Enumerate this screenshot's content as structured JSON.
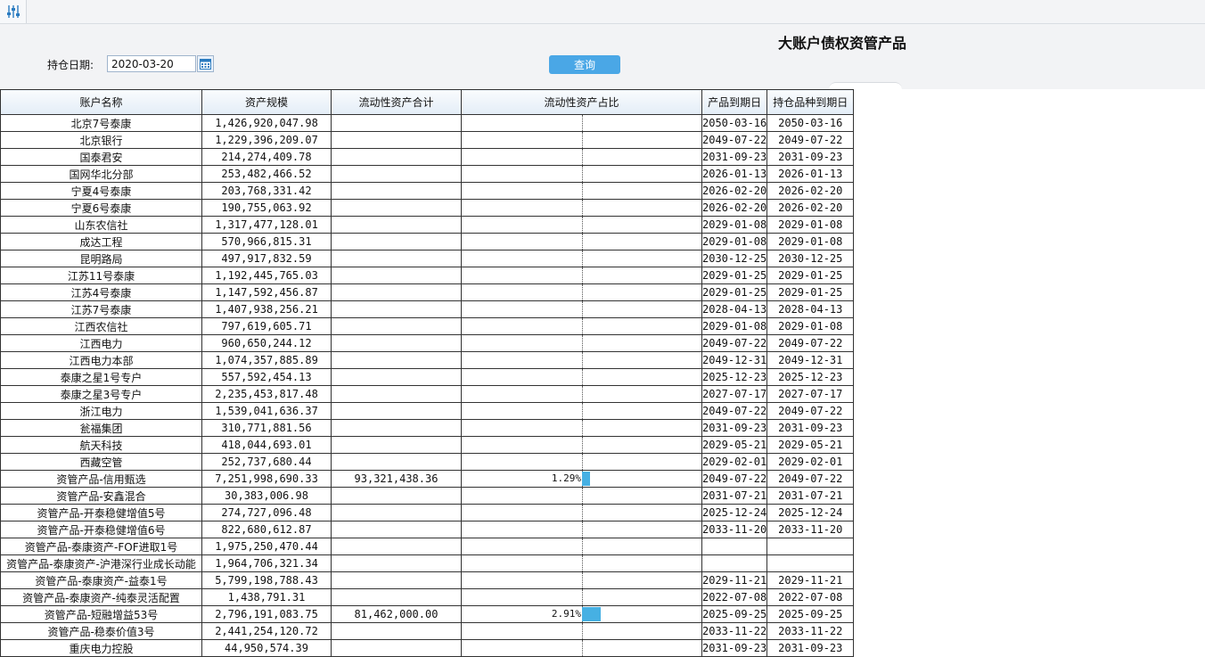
{
  "toolbar": {
    "filter_icon": "sliders-icon"
  },
  "page": {
    "title": "大账户债权资管产品"
  },
  "search": {
    "date_label": "持仓日期:",
    "date_value": "2020-03-20",
    "query_label": "查询"
  },
  "table": {
    "columns": [
      "账户名称",
      "资产规模",
      "流动性资产合计",
      "流动性资产占比",
      "产品到期日",
      "持仓品种到期日"
    ],
    "rows": [
      {
        "name": "北京7号泰康",
        "scale": "1,426,920,047.98",
        "liquid": "",
        "ratio": "",
        "ratio_value": 0,
        "due": "2050-03-16",
        "hold_due": "2050-03-16"
      },
      {
        "name": "北京银行",
        "scale": "1,229,396,209.07",
        "liquid": "",
        "ratio": "",
        "ratio_value": 0,
        "due": "2049-07-22",
        "hold_due": "2049-07-22"
      },
      {
        "name": "国泰君安",
        "scale": "214,274,409.78",
        "liquid": "",
        "ratio": "",
        "ratio_value": 0,
        "due": "2031-09-23",
        "hold_due": "2031-09-23"
      },
      {
        "name": "国网华北分部",
        "scale": "253,482,466.52",
        "liquid": "",
        "ratio": "",
        "ratio_value": 0,
        "due": "2026-01-13",
        "hold_due": "2026-01-13"
      },
      {
        "name": "宁夏4号泰康",
        "scale": "203,768,331.42",
        "liquid": "",
        "ratio": "",
        "ratio_value": 0,
        "due": "2026-02-20",
        "hold_due": "2026-02-20"
      },
      {
        "name": "宁夏6号泰康",
        "scale": "190,755,063.92",
        "liquid": "",
        "ratio": "",
        "ratio_value": 0,
        "due": "2026-02-20",
        "hold_due": "2026-02-20"
      },
      {
        "name": "山东农信社",
        "scale": "1,317,477,128.01",
        "liquid": "",
        "ratio": "",
        "ratio_value": 0,
        "due": "2029-01-08",
        "hold_due": "2029-01-08"
      },
      {
        "name": "成达工程",
        "scale": "570,966,815.31",
        "liquid": "",
        "ratio": "",
        "ratio_value": 0,
        "due": "2029-01-08",
        "hold_due": "2029-01-08"
      },
      {
        "name": "昆明路局",
        "scale": "497,917,832.59",
        "liquid": "",
        "ratio": "",
        "ratio_value": 0,
        "due": "2030-12-25",
        "hold_due": "2030-12-25"
      },
      {
        "name": "江苏11号泰康",
        "scale": "1,192,445,765.03",
        "liquid": "",
        "ratio": "",
        "ratio_value": 0,
        "due": "2029-01-25",
        "hold_due": "2029-01-25"
      },
      {
        "name": "江苏4号泰康",
        "scale": "1,147,592,456.87",
        "liquid": "",
        "ratio": "",
        "ratio_value": 0,
        "due": "2029-01-25",
        "hold_due": "2029-01-25"
      },
      {
        "name": "江苏7号泰康",
        "scale": "1,407,938,256.21",
        "liquid": "",
        "ratio": "",
        "ratio_value": 0,
        "due": "2028-04-13",
        "hold_due": "2028-04-13"
      },
      {
        "name": "江西农信社",
        "scale": "797,619,605.71",
        "liquid": "",
        "ratio": "",
        "ratio_value": 0,
        "due": "2029-01-08",
        "hold_due": "2029-01-08"
      },
      {
        "name": "江西电力",
        "scale": "960,650,244.12",
        "liquid": "",
        "ratio": "",
        "ratio_value": 0,
        "due": "2049-07-22",
        "hold_due": "2049-07-22"
      },
      {
        "name": "江西电力本部",
        "scale": "1,074,357,885.89",
        "liquid": "",
        "ratio": "",
        "ratio_value": 0,
        "due": "2049-12-31",
        "hold_due": "2049-12-31"
      },
      {
        "name": "泰康之星1号专户",
        "scale": "557,592,454.13",
        "liquid": "",
        "ratio": "",
        "ratio_value": 0,
        "due": "2025-12-23",
        "hold_due": "2025-12-23"
      },
      {
        "name": "泰康之星3号专户",
        "scale": "2,235,453,817.48",
        "liquid": "",
        "ratio": "",
        "ratio_value": 0,
        "due": "2027-07-17",
        "hold_due": "2027-07-17"
      },
      {
        "name": "浙江电力",
        "scale": "1,539,041,636.37",
        "liquid": "",
        "ratio": "",
        "ratio_value": 0,
        "due": "2049-07-22",
        "hold_due": "2049-07-22"
      },
      {
        "name": "瓮福集团",
        "scale": "310,771,881.56",
        "liquid": "",
        "ratio": "",
        "ratio_value": 0,
        "due": "2031-09-23",
        "hold_due": "2031-09-23"
      },
      {
        "name": "航天科技",
        "scale": "418,044,693.01",
        "liquid": "",
        "ratio": "",
        "ratio_value": 0,
        "due": "2029-05-21",
        "hold_due": "2029-05-21"
      },
      {
        "name": "西藏空管",
        "scale": "252,737,680.44",
        "liquid": "",
        "ratio": "",
        "ratio_value": 0,
        "due": "2029-02-01",
        "hold_due": "2029-02-01"
      },
      {
        "name": "资管产品-信用甄选",
        "scale": "7,251,998,690.33",
        "liquid": "93,321,438.36",
        "ratio": "1.29%",
        "ratio_value": 1.29,
        "due": "2049-07-22",
        "hold_due": "2049-07-22"
      },
      {
        "name": "资管产品-安鑫混合",
        "scale": "30,383,006.98",
        "liquid": "",
        "ratio": "",
        "ratio_value": 0,
        "due": "2031-07-21",
        "hold_due": "2031-07-21"
      },
      {
        "name": "资管产品-开泰稳健增值5号",
        "scale": "274,727,096.48",
        "liquid": "",
        "ratio": "",
        "ratio_value": 0,
        "due": "2025-12-24",
        "hold_due": "2025-12-24"
      },
      {
        "name": "资管产品-开泰稳健增值6号",
        "scale": "822,680,612.87",
        "liquid": "",
        "ratio": "",
        "ratio_value": 0,
        "due": "2033-11-20",
        "hold_due": "2033-11-20"
      },
      {
        "name": "资管产品-泰康资产-FOF进取1号",
        "scale": "1,975,250,470.44",
        "liquid": "",
        "ratio": "",
        "ratio_value": 0,
        "due": "",
        "hold_due": ""
      },
      {
        "name": "资管产品-泰康资产-沪港深行业成长动能",
        "scale": "1,964,706,321.34",
        "liquid": "",
        "ratio": "",
        "ratio_value": 0,
        "due": "",
        "hold_due": ""
      },
      {
        "name": "资管产品-泰康资产-益泰1号",
        "scale": "5,799,198,788.43",
        "liquid": "",
        "ratio": "",
        "ratio_value": 0,
        "due": "2029-11-21",
        "hold_due": "2029-11-21"
      },
      {
        "name": "资管产品-泰康资产-纯泰灵活配置",
        "scale": "1,438,791.31",
        "liquid": "",
        "ratio": "",
        "ratio_value": 0,
        "due": "2022-07-08",
        "hold_due": "2022-07-08"
      },
      {
        "name": "资管产品-短融增益53号",
        "scale": "2,796,191,083.75",
        "liquid": "81,462,000.00",
        "ratio": "2.91%",
        "ratio_value": 2.91,
        "due": "2025-09-25",
        "hold_due": "2025-09-25"
      },
      {
        "name": "资管产品-稳泰价值3号",
        "scale": "2,441,254,120.72",
        "liquid": "",
        "ratio": "",
        "ratio_value": 0,
        "due": "2033-11-22",
        "hold_due": "2033-11-22"
      },
      {
        "name": "重庆电力控股",
        "scale": "44,950,574.39",
        "liquid": "",
        "ratio": "",
        "ratio_value": 0,
        "due": "2031-09-23",
        "hold_due": "2031-09-23"
      }
    ]
  }
}
